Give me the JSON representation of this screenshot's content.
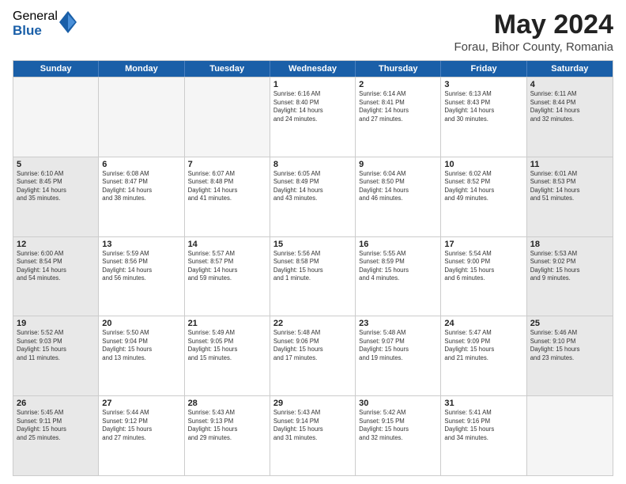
{
  "logo": {
    "general": "General",
    "blue": "Blue"
  },
  "title": {
    "month": "May 2024",
    "location": "Forau, Bihor County, Romania"
  },
  "header_days": [
    "Sunday",
    "Monday",
    "Tuesday",
    "Wednesday",
    "Thursday",
    "Friday",
    "Saturday"
  ],
  "weeks": [
    [
      {
        "day": "",
        "info": "",
        "empty": true
      },
      {
        "day": "",
        "info": "",
        "empty": true
      },
      {
        "day": "",
        "info": "",
        "empty": true
      },
      {
        "day": "1",
        "info": "Sunrise: 6:16 AM\nSunset: 8:40 PM\nDaylight: 14 hours\nand 24 minutes.",
        "empty": false
      },
      {
        "day": "2",
        "info": "Sunrise: 6:14 AM\nSunset: 8:41 PM\nDaylight: 14 hours\nand 27 minutes.",
        "empty": false
      },
      {
        "day": "3",
        "info": "Sunrise: 6:13 AM\nSunset: 8:43 PM\nDaylight: 14 hours\nand 30 minutes.",
        "empty": false
      },
      {
        "day": "4",
        "info": "Sunrise: 6:11 AM\nSunset: 8:44 PM\nDaylight: 14 hours\nand 32 minutes.",
        "empty": false,
        "shaded": true
      }
    ],
    [
      {
        "day": "5",
        "info": "Sunrise: 6:10 AM\nSunset: 8:45 PM\nDaylight: 14 hours\nand 35 minutes.",
        "empty": false,
        "shaded": true
      },
      {
        "day": "6",
        "info": "Sunrise: 6:08 AM\nSunset: 8:47 PM\nDaylight: 14 hours\nand 38 minutes.",
        "empty": false
      },
      {
        "day": "7",
        "info": "Sunrise: 6:07 AM\nSunset: 8:48 PM\nDaylight: 14 hours\nand 41 minutes.",
        "empty": false
      },
      {
        "day": "8",
        "info": "Sunrise: 6:05 AM\nSunset: 8:49 PM\nDaylight: 14 hours\nand 43 minutes.",
        "empty": false
      },
      {
        "day": "9",
        "info": "Sunrise: 6:04 AM\nSunset: 8:50 PM\nDaylight: 14 hours\nand 46 minutes.",
        "empty": false
      },
      {
        "day": "10",
        "info": "Sunrise: 6:02 AM\nSunset: 8:52 PM\nDaylight: 14 hours\nand 49 minutes.",
        "empty": false
      },
      {
        "day": "11",
        "info": "Sunrise: 6:01 AM\nSunset: 8:53 PM\nDaylight: 14 hours\nand 51 minutes.",
        "empty": false,
        "shaded": true
      }
    ],
    [
      {
        "day": "12",
        "info": "Sunrise: 6:00 AM\nSunset: 8:54 PM\nDaylight: 14 hours\nand 54 minutes.",
        "empty": false,
        "shaded": true
      },
      {
        "day": "13",
        "info": "Sunrise: 5:59 AM\nSunset: 8:56 PM\nDaylight: 14 hours\nand 56 minutes.",
        "empty": false
      },
      {
        "day": "14",
        "info": "Sunrise: 5:57 AM\nSunset: 8:57 PM\nDaylight: 14 hours\nand 59 minutes.",
        "empty": false
      },
      {
        "day": "15",
        "info": "Sunrise: 5:56 AM\nSunset: 8:58 PM\nDaylight: 15 hours\nand 1 minute.",
        "empty": false
      },
      {
        "day": "16",
        "info": "Sunrise: 5:55 AM\nSunset: 8:59 PM\nDaylight: 15 hours\nand 4 minutes.",
        "empty": false
      },
      {
        "day": "17",
        "info": "Sunrise: 5:54 AM\nSunset: 9:00 PM\nDaylight: 15 hours\nand 6 minutes.",
        "empty": false
      },
      {
        "day": "18",
        "info": "Sunrise: 5:53 AM\nSunset: 9:02 PM\nDaylight: 15 hours\nand 9 minutes.",
        "empty": false,
        "shaded": true
      }
    ],
    [
      {
        "day": "19",
        "info": "Sunrise: 5:52 AM\nSunset: 9:03 PM\nDaylight: 15 hours\nand 11 minutes.",
        "empty": false,
        "shaded": true
      },
      {
        "day": "20",
        "info": "Sunrise: 5:50 AM\nSunset: 9:04 PM\nDaylight: 15 hours\nand 13 minutes.",
        "empty": false
      },
      {
        "day": "21",
        "info": "Sunrise: 5:49 AM\nSunset: 9:05 PM\nDaylight: 15 hours\nand 15 minutes.",
        "empty": false
      },
      {
        "day": "22",
        "info": "Sunrise: 5:48 AM\nSunset: 9:06 PM\nDaylight: 15 hours\nand 17 minutes.",
        "empty": false
      },
      {
        "day": "23",
        "info": "Sunrise: 5:48 AM\nSunset: 9:07 PM\nDaylight: 15 hours\nand 19 minutes.",
        "empty": false
      },
      {
        "day": "24",
        "info": "Sunrise: 5:47 AM\nSunset: 9:09 PM\nDaylight: 15 hours\nand 21 minutes.",
        "empty": false
      },
      {
        "day": "25",
        "info": "Sunrise: 5:46 AM\nSunset: 9:10 PM\nDaylight: 15 hours\nand 23 minutes.",
        "empty": false,
        "shaded": true
      }
    ],
    [
      {
        "day": "26",
        "info": "Sunrise: 5:45 AM\nSunset: 9:11 PM\nDaylight: 15 hours\nand 25 minutes.",
        "empty": false,
        "shaded": true
      },
      {
        "day": "27",
        "info": "Sunrise: 5:44 AM\nSunset: 9:12 PM\nDaylight: 15 hours\nand 27 minutes.",
        "empty": false
      },
      {
        "day": "28",
        "info": "Sunrise: 5:43 AM\nSunset: 9:13 PM\nDaylight: 15 hours\nand 29 minutes.",
        "empty": false
      },
      {
        "day": "29",
        "info": "Sunrise: 5:43 AM\nSunset: 9:14 PM\nDaylight: 15 hours\nand 31 minutes.",
        "empty": false
      },
      {
        "day": "30",
        "info": "Sunrise: 5:42 AM\nSunset: 9:15 PM\nDaylight: 15 hours\nand 32 minutes.",
        "empty": false
      },
      {
        "day": "31",
        "info": "Sunrise: 5:41 AM\nSunset: 9:16 PM\nDaylight: 15 hours\nand 34 minutes.",
        "empty": false
      },
      {
        "day": "",
        "info": "",
        "empty": true,
        "shaded": true
      }
    ]
  ]
}
